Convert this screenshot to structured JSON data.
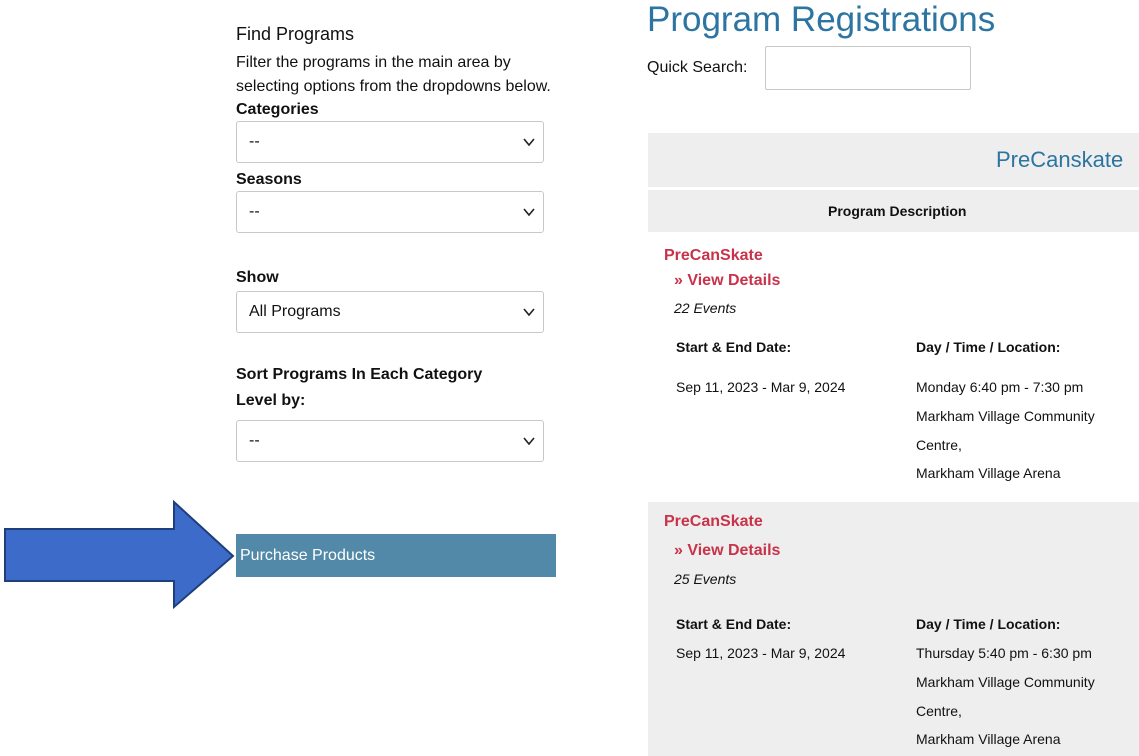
{
  "sidebar": {
    "title": "Find Programs",
    "description": "Filter the programs in the main area by selecting options from the dropdowns below.",
    "categories_label": "Categories",
    "categories_value": "--",
    "seasons_label": "Seasons",
    "seasons_value": "--",
    "show_label": "Show",
    "show_value": "All Programs",
    "sort_label": "Sort Programs In Each Category",
    "level_label": "Level by:",
    "level_value": "--",
    "purchase_button": "Purchase Products"
  },
  "main": {
    "title": "Program Registrations",
    "quick_search_label": "Quick Search:",
    "quick_search_value": "",
    "category_name": "PreCanskate",
    "column_header": "Program Description",
    "programs": [
      {
        "name": "PreCanSkate",
        "details_link": "» View Details",
        "events": "22 Events",
        "date_label": "Start & End Date:",
        "date_value": "Sep 11, 2023 - Mar 9, 2024",
        "location_label": "Day / Time / Location:",
        "time": "Monday 6:40 pm - 7:30 pm",
        "location_line1": "Markham Village Community",
        "location_line2": "Centre,",
        "location_line3": "Markham Village Arena"
      },
      {
        "name": "PreCanSkate",
        "details_link": "» View Details",
        "events": "25 Events",
        "date_label": "Start & End Date:",
        "date_value": "Sep 11, 2023 - Mar 9, 2024",
        "location_label": "Day / Time / Location:",
        "time": "Thursday 5:40 pm - 6:30 pm",
        "location_line1": "Markham Village Community",
        "location_line2": "Centre,",
        "location_line3": "Markham Village Arena"
      }
    ]
  },
  "colors": {
    "title_blue": "#2c74a1",
    "program_red": "#c8334a",
    "button_blue": "#5289a8",
    "arrow_fill": "#3d6bc9",
    "arrow_stroke": "#1e3f7a",
    "row_gray": "#eeeeee"
  },
  "icons": {
    "arrow": "right-arrow-icon",
    "select": "chevron-down-icon"
  }
}
